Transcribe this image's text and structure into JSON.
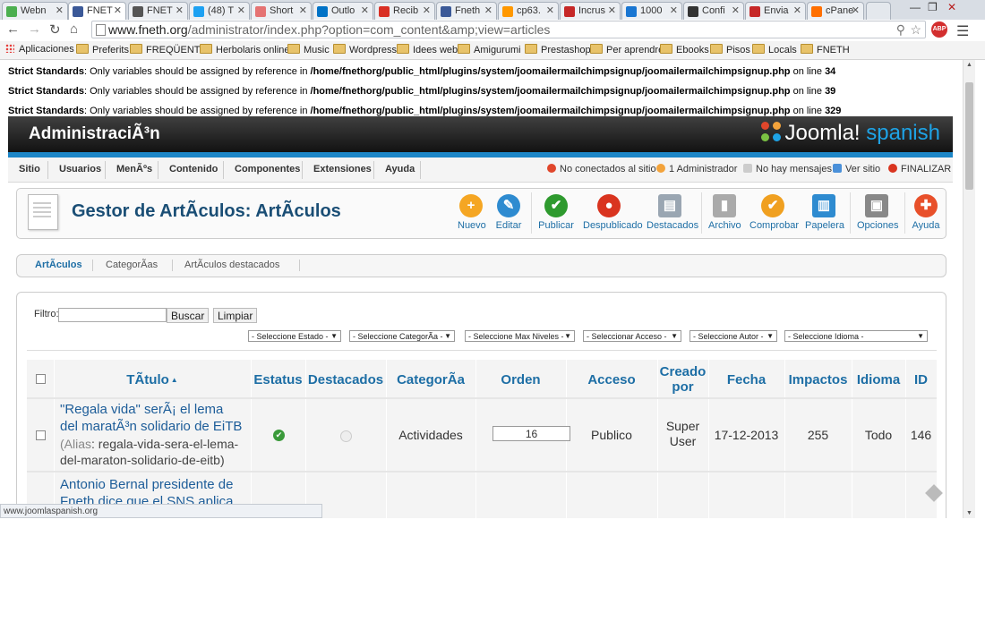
{
  "browser": {
    "tabs": [
      {
        "label": "Webn",
        "color": "#4caf50"
      },
      {
        "label": "FNET",
        "color": "#3b5998",
        "active": true
      },
      {
        "label": "FNET",
        "color": "#555555"
      },
      {
        "label": "(48) T",
        "color": "#1da1f2"
      },
      {
        "label": "Short",
        "color": "#e57373"
      },
      {
        "label": "Outlo",
        "color": "#0072c6"
      },
      {
        "label": "Recib",
        "color": "#d93025"
      },
      {
        "label": "Fneth",
        "color": "#3b5998"
      },
      {
        "label": "cp63.",
        "color": "#ff9800"
      },
      {
        "label": "Incrus",
        "color": "#c62828"
      },
      {
        "label": "1000",
        "color": "#1976d2"
      },
      {
        "label": "Confi",
        "color": "#333333"
      },
      {
        "label": "Envia",
        "color": "#c62828"
      },
      {
        "label": "cPane",
        "color": "#ff6f00"
      }
    ],
    "url_host": "www.fneth.org",
    "url_path": "/administrator/index.php?option=com_content&amp;view=articles",
    "abp_label": "ABP",
    "bookmarks": [
      "Aplicaciones",
      "Preferits",
      "FREQÜENTS",
      "Herbolaris online",
      "Music",
      "Wordpress",
      "Idees web",
      "Amigurumi",
      "Prestashop",
      "Per aprendre",
      "Ebooks",
      "Pisos",
      "Locals",
      "FNETH"
    ],
    "status_url": "www.joomlaspanish.org"
  },
  "warnings": [
    {
      "label": "Strict Standards",
      "text": ": Only variables should be assigned by reference in ",
      "path": "/home/fnethorg/public_html/plugins/system/joomailermailchimpsignup/joomailermailchimpsignup.php",
      "suffix": " on line ",
      "line": "34"
    },
    {
      "label": "Strict Standards",
      "text": ": Only variables should be assigned by reference in ",
      "path": "/home/fnethorg/public_html/plugins/system/joomailermailchimpsignup/joomailermailchimpsignup.php",
      "suffix": " on line ",
      "line": "39"
    },
    {
      "label": "Strict Standards",
      "text": ": Only variables should be assigned by reference in ",
      "path": "/home/fnethorg/public_html/plugins/system/joomailermailchimpsignup/joomailermailchimpsignup.php",
      "suffix": " on line ",
      "line": "329"
    }
  ],
  "header": {
    "title": "AdministraciÃ³n",
    "logo_word": "Joomla!",
    "logo_lang": "spanish"
  },
  "menu": {
    "items": [
      "Sitio",
      "Usuarios",
      "MenÃºs",
      "Contenido",
      "Componentes",
      "Extensiones",
      "Ayuda"
    ],
    "status": {
      "visitors": "No conectados al sitio",
      "admins": "1 Administrador",
      "messages": "No hay mensajes",
      "view_site": "Ver sitio",
      "logout": "FINALIZAR"
    }
  },
  "toolbar": {
    "page_title": "Gestor de ArtÃculos: ArtÃculos",
    "buttons": [
      {
        "label": "Nuevo",
        "color": "#f5a623",
        "glyph": "+"
      },
      {
        "label": "Editar",
        "color": "#2e8bd0",
        "glyph": "✎"
      },
      {
        "label": "Publicar",
        "color": "#2e9a2e",
        "glyph": "✔"
      },
      {
        "label": "Despublicado",
        "color": "#d9341f",
        "glyph": "●"
      },
      {
        "label": "Destacados",
        "color": "#9aa6b2",
        "glyph": "▤"
      },
      {
        "label": "Archivo",
        "color": "#aaaaaa",
        "glyph": "▮"
      },
      {
        "label": "Comprobar",
        "color": "#f0a020",
        "glyph": "✔"
      },
      {
        "label": "Papelera",
        "color": "#2e8bd0",
        "glyph": "🗑"
      },
      {
        "label": "Opciones",
        "color": "#888888",
        "glyph": "▣"
      },
      {
        "label": "Ayuda",
        "color": "#e8502a",
        "glyph": "✚"
      }
    ]
  },
  "subtabs": [
    "ArtÃculos",
    "CategorÃas",
    "ArtÃculos destacados"
  ],
  "filters": {
    "label": "Filtro:",
    "value": "",
    "search_button": "Buscar",
    "clear_button": "Limpiar",
    "selects": [
      "- Seleccione Estado -",
      "- Seleccione CategorÃa -",
      "- Seleccione Max Niveles -",
      "- Seleccionar Acceso -",
      "- Seleccione Autor -",
      "- Seleccione Idioma -"
    ]
  },
  "table": {
    "columns": [
      "TÃtulo",
      "Estatus",
      "Destacados",
      "CategorÃa",
      "Orden",
      "Acceso",
      "Creado por",
      "Fecha",
      "Impactos",
      "Idioma",
      "ID"
    ],
    "sort_indicator": "▲",
    "rows": [
      {
        "title_line1": "\"Regala vida\" serÃ¡ el lema",
        "title_line2": "del maratÃ³n solidario de EiTB",
        "alias_label": "(Alias",
        "alias_line1": ": regala-vida-sera-el-lema-",
        "alias_line2": "del-maraton-solidario-de-eitb)",
        "status_glyph": "✔",
        "category": "Actividades",
        "order": "16",
        "access": "Publico",
        "created_by_1": "Super",
        "created_by_2": "User",
        "date": "17-12-2013",
        "hits": "255",
        "language": "Todo",
        "id": "146"
      },
      {
        "title_line1": "Antonio Bernal presidente de",
        "title_line2": "Fneth dice que el SNS aplica"
      }
    ]
  }
}
